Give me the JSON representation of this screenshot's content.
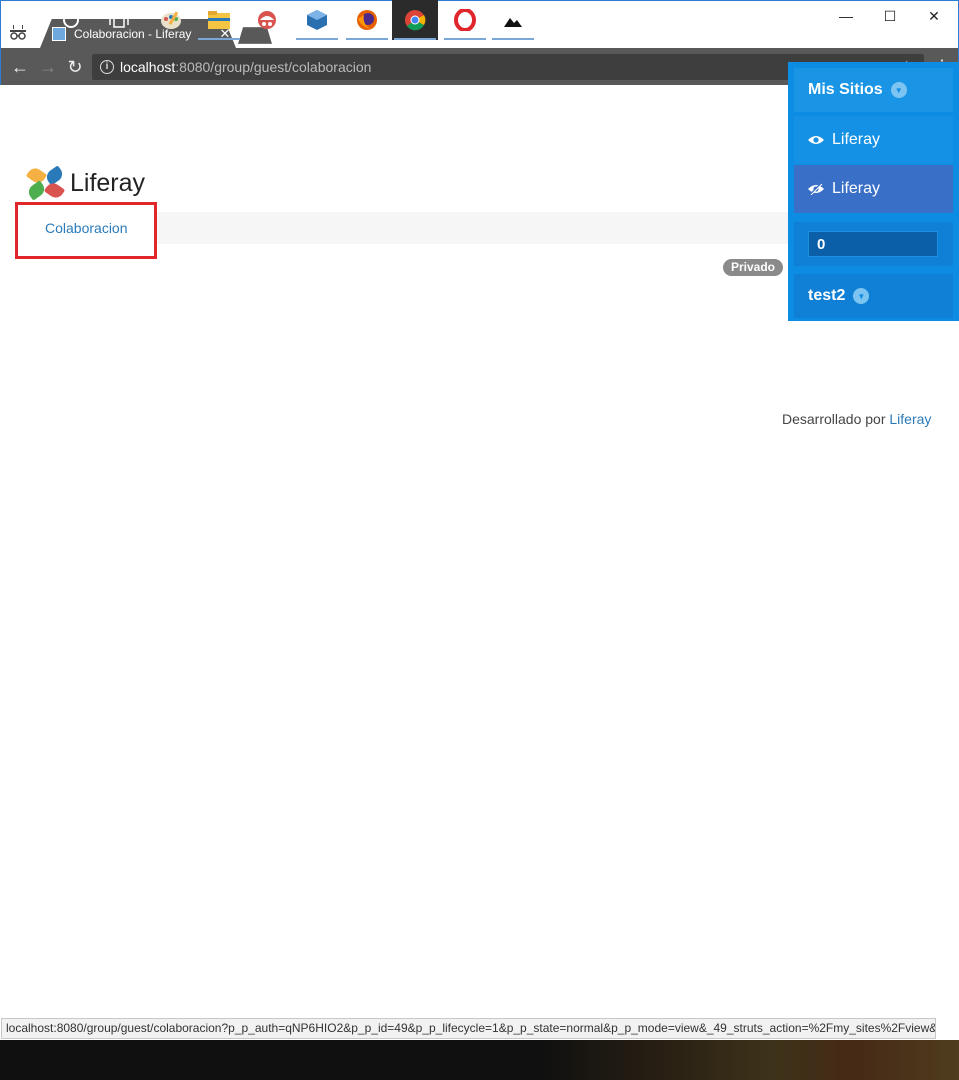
{
  "browser": {
    "tab_title": "Colaboracion - Liferay",
    "tab_close": "✕",
    "url_host": "localhost",
    "url_rest": ":8080/group/guest/colaboracion",
    "window_controls": {
      "minimize": "—",
      "maximize": "☐",
      "close": "✕"
    },
    "status_url": "localhost:8080/group/guest/colaboracion?p_p_auth=qNP6HIO2&p_p_id=49&p_p_lifecycle=1&p_p_state=normal&p_p_mode=view&_49_struts_action=%2Fmy_sites%2Fview&..."
  },
  "site": {
    "logo_text": "Liferay",
    "nav_items": [
      {
        "label": "Colaboracion"
      }
    ],
    "privado_badge": "Privado"
  },
  "dockbar": {
    "my_sites": "Mis Sitios",
    "sites": [
      {
        "label": "Liferay",
        "icon": "eye-icon"
      },
      {
        "label": "Liferay",
        "icon": "eye-slash-icon"
      }
    ],
    "notification_count": "0",
    "user_name": "test2"
  },
  "footer": {
    "prefix": "Desarrollado por",
    "link": "Liferay"
  },
  "taskbar": {
    "apps": [
      "windows-start-icon",
      "cortana-search-icon",
      "task-view-icon",
      "paint-icon",
      "file-explorer-icon",
      "snipping-tool-icon",
      "virtualbox-icon",
      "firefox-icon",
      "chrome-icon",
      "opera-icon",
      "photos-icon"
    ]
  },
  "colors": {
    "dockbar_blue": "#0d8ce3",
    "avatar_orange": "#f4b042",
    "highlight_red": "#e0252b",
    "link_blue": "#2a7ab9"
  }
}
